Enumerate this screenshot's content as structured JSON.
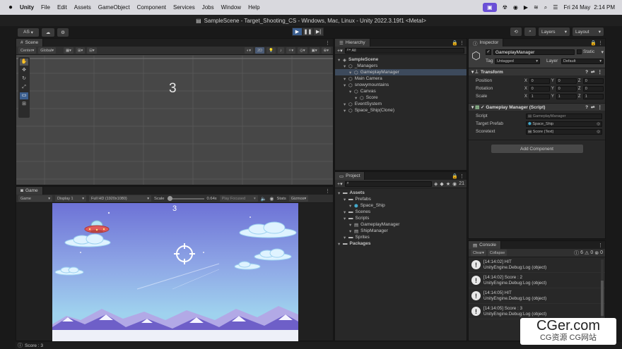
{
  "macbar": {
    "app": "Unity",
    "menus": [
      "File",
      "Edit",
      "Assets",
      "GameObject",
      "Component",
      "Services",
      "Jobs",
      "Window",
      "Help"
    ],
    "datetime": "Fri 24 May",
    "time": "2:14 PM"
  },
  "titlebar": {
    "title": "SampleScene - Target_Shooting_CS - Windows, Mac, Linux - Unity 2022.3.19f1 <Metal>"
  },
  "toolbar": {
    "account": "AS",
    "layers": "Layers",
    "layout": "Layout"
  },
  "scene": {
    "tab": "Scene",
    "pivot": "Center",
    "space": "Global",
    "mode2d": "2D",
    "score_text": "3"
  },
  "game": {
    "tab": "Game",
    "mode": "Game",
    "display": "Display 1",
    "resolution": "Full HD (1920x1080)",
    "scale_label": "Scale",
    "scale_value": "0.64x",
    "play_focused": "Play Focused",
    "stats": "Stats",
    "gizmos": "Gizmos",
    "score_text": "3",
    "sky_top": "#6d72d6",
    "sky_bottom": "#9fd2ee"
  },
  "hierarchy": {
    "tab": "Hierarchy",
    "search": "All",
    "items": [
      {
        "label": "SampleScene",
        "indent": 0,
        "bold": true
      },
      {
        "label": "_Managers",
        "indent": 1
      },
      {
        "label": "GameplayManager",
        "indent": 2,
        "selected": true
      },
      {
        "label": "Main Camera",
        "indent": 1
      },
      {
        "label": "snowymountains",
        "indent": 1
      },
      {
        "label": "Canvas",
        "indent": 2
      },
      {
        "label": "Score",
        "indent": 3
      },
      {
        "label": "EventSystem",
        "indent": 1
      },
      {
        "label": "Space_Ship(Clone)",
        "indent": 1
      }
    ]
  },
  "project": {
    "tab": "Project",
    "count": "21",
    "items": [
      {
        "label": "Assets",
        "indent": 0,
        "bold": true
      },
      {
        "label": "Prefabs",
        "indent": 1
      },
      {
        "label": "Space_Ship",
        "indent": 2
      },
      {
        "label": "Scenes",
        "indent": 1
      },
      {
        "label": "Scripts",
        "indent": 1
      },
      {
        "label": "GameplayManager",
        "indent": 2
      },
      {
        "label": "ShipManager",
        "indent": 2
      },
      {
        "label": "Sprites",
        "indent": 1
      },
      {
        "label": "Packages",
        "indent": 0,
        "bold": true
      }
    ]
  },
  "inspector": {
    "tab": "Inspector",
    "object_name": "GameplayManager",
    "static": "Static",
    "tag_label": "Tag",
    "tag_value": "Untagged",
    "layer_label": "Layer",
    "layer_value": "Default",
    "transform": {
      "title": "Transform",
      "position": "Position",
      "rotation": "Rotation",
      "scale": "Scale",
      "pos": [
        "0",
        "0",
        "0"
      ],
      "rot": [
        "0",
        "0",
        "0"
      ],
      "scl": [
        "1",
        "1",
        "1"
      ]
    },
    "script_component": {
      "title": "Gameplay Manager (Script)",
      "script_label": "Script",
      "script_value": "GameplayManager",
      "prefab_label": "Target Prefab",
      "prefab_value": "Space_Ship",
      "scoretext_label": "Scoretext",
      "scoretext_value": "Score (Text)"
    },
    "add_component": "Add Component"
  },
  "console": {
    "tab": "Console",
    "clear": "Clear",
    "collapse": "Collapse",
    "count_info": "6",
    "count_err": "0",
    "logs": [
      {
        "l1": "[14:14:02] HIT",
        "l2": "UnityEngine.Debug:Log (object)"
      },
      {
        "l1": "[14:14:02] Score : 2",
        "l2": "UnityEngine.Debug:Log (object)"
      },
      {
        "l1": "[14:14:05] HIT",
        "l2": "UnityEngine.Debug:Log (object)"
      },
      {
        "l1": "[14:14:05] Score : 3",
        "l2": "UnityEngine.Debug:Log (object)"
      }
    ]
  },
  "statusbar": {
    "text": "Score : 3"
  },
  "watermark": {
    "line1": "CGer.com",
    "line2": "CG资源 CG网站"
  }
}
